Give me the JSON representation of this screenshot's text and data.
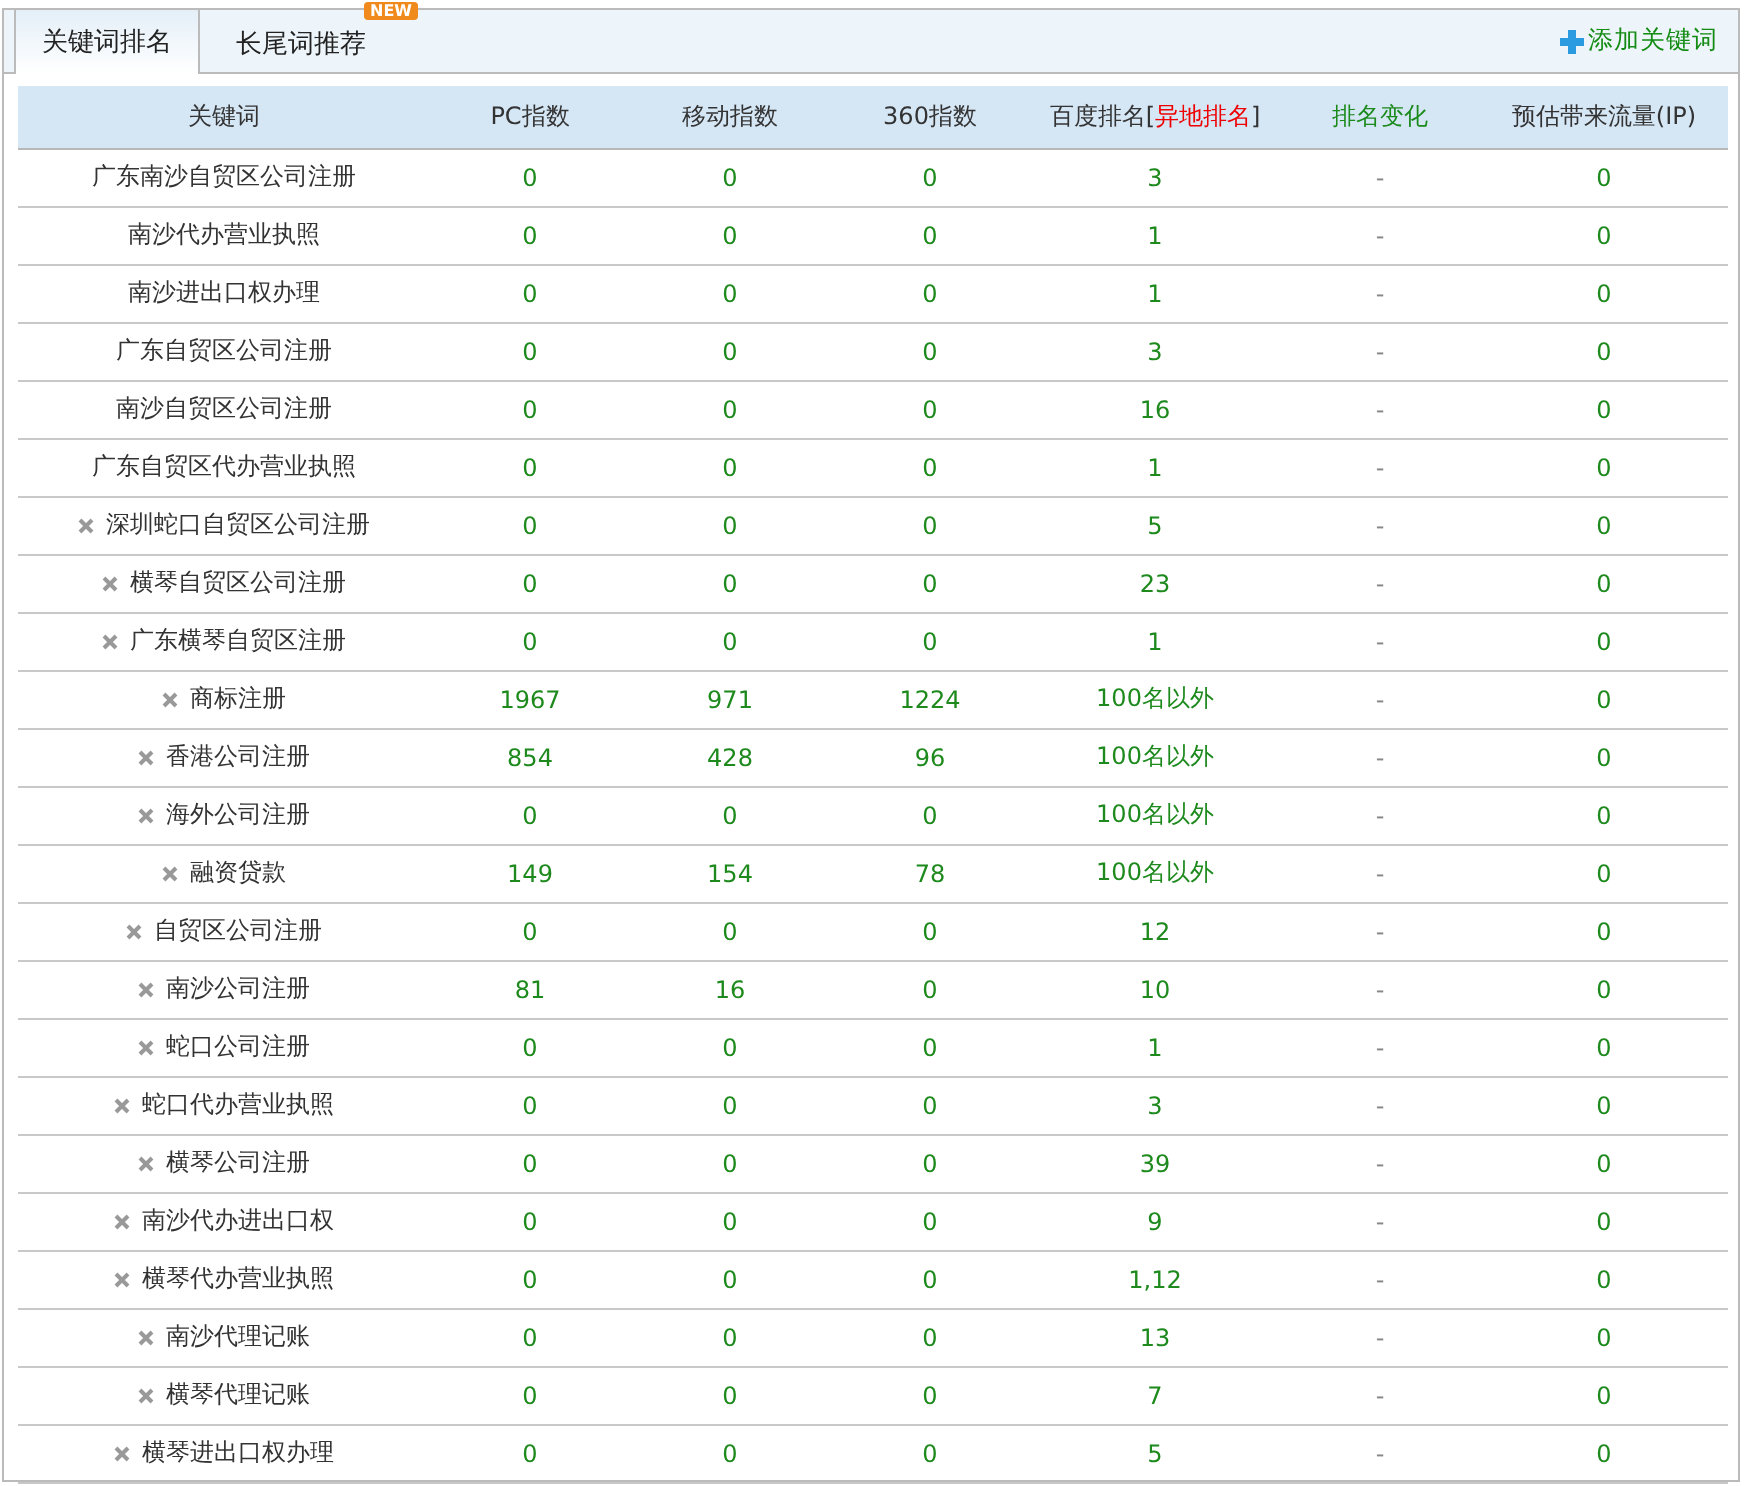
{
  "tabs": [
    {
      "label": "关键词排名",
      "selected": true
    },
    {
      "label": "长尾词推荐",
      "selected": false,
      "badge": "NEW"
    }
  ],
  "add_button": "添加关键词",
  "table": {
    "columns": [
      {
        "parts": [
          {
            "text": "关键词",
            "kind": "plain"
          }
        ],
        "kind": "text"
      },
      {
        "parts": [
          {
            "text": "PC指数",
            "kind": "plain"
          }
        ],
        "kind": "number"
      },
      {
        "parts": [
          {
            "text": "移动指数",
            "kind": "plain"
          }
        ],
        "kind": "number"
      },
      {
        "parts": [
          {
            "text": "360指数",
            "kind": "plain"
          }
        ],
        "kind": "number"
      },
      {
        "parts": [
          {
            "text": "百度排名[",
            "kind": "plain"
          },
          {
            "text": "异地排名",
            "kind": "alert"
          },
          {
            "text": "]",
            "kind": "plain"
          }
        ],
        "kind": "number"
      },
      {
        "parts": [
          {
            "text": "排名变化",
            "kind": "positive"
          }
        ],
        "kind": "muted"
      },
      {
        "parts": [
          {
            "text": "预估带来流量(IP)",
            "kind": "plain"
          }
        ],
        "kind": "number"
      }
    ],
    "rows": [
      {
        "removable": false,
        "cells": [
          "广东南沙自贸区公司注册",
          "0",
          "0",
          "0",
          "3",
          "-",
          "0"
        ]
      },
      {
        "removable": false,
        "cells": [
          "南沙代办营业执照",
          "0",
          "0",
          "0",
          "1",
          "-",
          "0"
        ]
      },
      {
        "removable": false,
        "cells": [
          "南沙进出口权办理",
          "0",
          "0",
          "0",
          "1",
          "-",
          "0"
        ]
      },
      {
        "removable": false,
        "cells": [
          "广东自贸区公司注册",
          "0",
          "0",
          "0",
          "3",
          "-",
          "0"
        ]
      },
      {
        "removable": false,
        "cells": [
          "南沙自贸区公司注册",
          "0",
          "0",
          "0",
          "16",
          "-",
          "0"
        ]
      },
      {
        "removable": false,
        "cells": [
          "广东自贸区代办营业执照",
          "0",
          "0",
          "0",
          "1",
          "-",
          "0"
        ]
      },
      {
        "removable": true,
        "cells": [
          "深圳蛇口自贸区公司注册",
          "0",
          "0",
          "0",
          "5",
          "-",
          "0"
        ]
      },
      {
        "removable": true,
        "cells": [
          "横琴自贸区公司注册",
          "0",
          "0",
          "0",
          "23",
          "-",
          "0"
        ]
      },
      {
        "removable": true,
        "cells": [
          "广东横琴自贸区注册",
          "0",
          "0",
          "0",
          "1",
          "-",
          "0"
        ]
      },
      {
        "removable": true,
        "cells": [
          "商标注册",
          "1967",
          "971",
          "1224",
          "100名以外",
          "-",
          "0"
        ]
      },
      {
        "removable": true,
        "cells": [
          "香港公司注册",
          "854",
          "428",
          "96",
          "100名以外",
          "-",
          "0"
        ]
      },
      {
        "removable": true,
        "cells": [
          "海外公司注册",
          "0",
          "0",
          "0",
          "100名以外",
          "-",
          "0"
        ]
      },
      {
        "removable": true,
        "cells": [
          "融资贷款",
          "149",
          "154",
          "78",
          "100名以外",
          "-",
          "0"
        ]
      },
      {
        "removable": true,
        "cells": [
          "自贸区公司注册",
          "0",
          "0",
          "0",
          "12",
          "-",
          "0"
        ]
      },
      {
        "removable": true,
        "cells": [
          "南沙公司注册",
          "81",
          "16",
          "0",
          "10",
          "-",
          "0"
        ]
      },
      {
        "removable": true,
        "cells": [
          "蛇口公司注册",
          "0",
          "0",
          "0",
          "1",
          "-",
          "0"
        ]
      },
      {
        "removable": true,
        "cells": [
          "蛇口代办营业执照",
          "0",
          "0",
          "0",
          "3",
          "-",
          "0"
        ]
      },
      {
        "removable": true,
        "cells": [
          "横琴公司注册",
          "0",
          "0",
          "0",
          "39",
          "-",
          "0"
        ]
      },
      {
        "removable": true,
        "cells": [
          "南沙代办进出口权",
          "0",
          "0",
          "0",
          "9",
          "-",
          "0"
        ]
      },
      {
        "removable": true,
        "cells": [
          "横琴代办营业执照",
          "0",
          "0",
          "0",
          "1,12",
          "-",
          "0"
        ]
      },
      {
        "removable": true,
        "cells": [
          "南沙代理记账",
          "0",
          "0",
          "0",
          "13",
          "-",
          "0"
        ]
      },
      {
        "removable": true,
        "cells": [
          "横琴代理记账",
          "0",
          "0",
          "0",
          "7",
          "-",
          "0"
        ]
      },
      {
        "removable": true,
        "cells": [
          "横琴进出口权办理",
          "0",
          "0",
          "0",
          "5",
          "-",
          "0"
        ]
      }
    ]
  }
}
